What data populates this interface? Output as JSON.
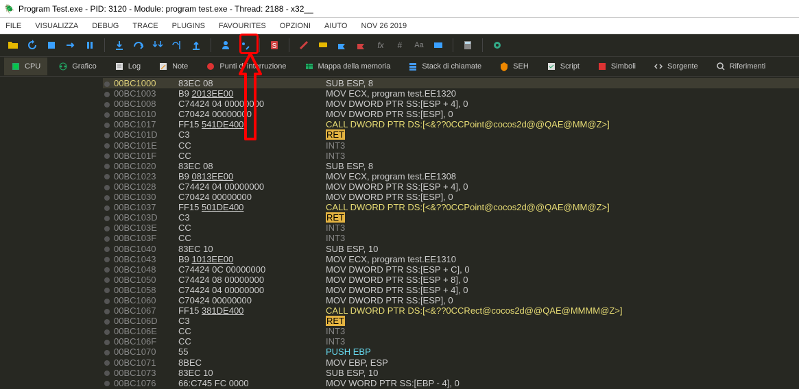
{
  "title": "Program Test.exe - PID: 3120 - Module: program test.exe - Thread: 2188 - x32__",
  "menus": [
    "FILE",
    "VISUALIZZA",
    "DEBUG",
    "TRACE",
    "PLUGINS",
    "FAVOURITES",
    "OPZIONI",
    "AIUTO",
    "NOV 26 2019"
  ],
  "tabs": [
    {
      "label": "CPU",
      "active": true,
      "id": "cpu"
    },
    {
      "label": "Grafico",
      "active": false,
      "id": "grafico"
    },
    {
      "label": "Log",
      "active": false,
      "id": "log"
    },
    {
      "label": "Note",
      "active": false,
      "id": "note"
    },
    {
      "label": "Punti di interruzione",
      "active": false,
      "id": "breakpoints"
    },
    {
      "label": "Mappa della memoria",
      "active": false,
      "id": "memmap"
    },
    {
      "label": "Stack di chiamate",
      "active": false,
      "id": "callstack"
    },
    {
      "label": "SEH",
      "active": false,
      "id": "seh"
    },
    {
      "label": "Script",
      "active": false,
      "id": "script"
    },
    {
      "label": "Simboli",
      "active": false,
      "id": "simboli"
    },
    {
      "label": "Sorgente",
      "active": false,
      "id": "sorgente"
    },
    {
      "label": "Riferimenti",
      "active": false,
      "id": "riferimenti"
    }
  ],
  "rows": [
    {
      "addr": "00BC1000",
      "sel": true,
      "b": "83EC 08",
      "bu": "",
      "ins": "SUB ESP, 8"
    },
    {
      "addr": "00BC1003",
      "b": "B9 ",
      "bu": "2013EE00",
      "ins": "MOV ECX, program test.EE1320"
    },
    {
      "addr": "00BC1008",
      "b": "C74424 04 00000000",
      "ins": "MOV DWORD PTR SS:[ESP + 4], 0"
    },
    {
      "addr": "00BC1010",
      "b": "C70424 00000000",
      "ins": "MOV DWORD PTR SS:[ESP], 0"
    },
    {
      "addr": "00BC1017",
      "b": "FF15 ",
      "bu": "541DE400",
      "ins": "CALL DWORD PTR DS:[<&??0CCPoint@cocos2d@@QAE@MM@Z>]",
      "kind": "call"
    },
    {
      "addr": "00BC101D",
      "b": "C3",
      "ins": "RET",
      "kind": "ret"
    },
    {
      "addr": "00BC101E",
      "b": "CC",
      "ins": "INT3",
      "kind": "int3"
    },
    {
      "addr": "00BC101F",
      "b": "CC",
      "ins": "INT3",
      "kind": "int3"
    },
    {
      "addr": "00BC1020",
      "b": "83EC 08",
      "ins": "SUB ESP, 8"
    },
    {
      "addr": "00BC1023",
      "b": "B9 ",
      "bu": "0813EE00",
      "ins": "MOV ECX, program test.EE1308"
    },
    {
      "addr": "00BC1028",
      "b": "C74424 04 00000000",
      "ins": "MOV DWORD PTR SS:[ESP + 4], 0"
    },
    {
      "addr": "00BC1030",
      "b": "C70424 00000000",
      "ins": "MOV DWORD PTR SS:[ESP], 0"
    },
    {
      "addr": "00BC1037",
      "b": "FF15 ",
      "bu": "501DE400",
      "ins": "CALL DWORD PTR DS:[<&??0CCPoint@cocos2d@@QAE@MM@Z>]",
      "kind": "call"
    },
    {
      "addr": "00BC103D",
      "b": "C3",
      "ins": "RET",
      "kind": "ret"
    },
    {
      "addr": "00BC103E",
      "b": "CC",
      "ins": "INT3",
      "kind": "int3"
    },
    {
      "addr": "00BC103F",
      "b": "CC",
      "ins": "INT3",
      "kind": "int3"
    },
    {
      "addr": "00BC1040",
      "b": "83EC 10",
      "ins": "SUB ESP, 10"
    },
    {
      "addr": "00BC1043",
      "b": "B9 ",
      "bu": "1013EE00",
      "ins": "MOV ECX, program test.EE1310"
    },
    {
      "addr": "00BC1048",
      "b": "C74424 0C 00000000",
      "ins": "MOV DWORD PTR SS:[ESP + C], 0"
    },
    {
      "addr": "00BC1050",
      "b": "C74424 08 00000000",
      "ins": "MOV DWORD PTR SS:[ESP + 8], 0"
    },
    {
      "addr": "00BC1058",
      "b": "C74424 04 00000000",
      "ins": "MOV DWORD PTR SS:[ESP + 4], 0"
    },
    {
      "addr": "00BC1060",
      "b": "C70424 00000000",
      "ins": "MOV DWORD PTR SS:[ESP], 0"
    },
    {
      "addr": "00BC1067",
      "b": "FF15 ",
      "bu": "381DE400",
      "ins": "CALL DWORD PTR DS:[<&??0CCRect@cocos2d@@QAE@MMMM@Z>]",
      "kind": "call"
    },
    {
      "addr": "00BC106D",
      "b": "C3",
      "ins": "RET",
      "kind": "ret"
    },
    {
      "addr": "00BC106E",
      "b": "CC",
      "ins": "INT3",
      "kind": "int3"
    },
    {
      "addr": "00BC106F",
      "b": "CC",
      "ins": "INT3",
      "kind": "int3"
    },
    {
      "addr": "00BC1070",
      "b": "55",
      "ins": "PUSH EBP",
      "kind": "push"
    },
    {
      "addr": "00BC1071",
      "b": "8BEC",
      "ins": "MOV EBP, ESP"
    },
    {
      "addr": "00BC1073",
      "b": "83EC 10",
      "ins": "SUB ESP, 10"
    },
    {
      "addr": "00BC1076",
      "b": "66:C745 FC 0000",
      "ins": "MOV WORD PTR SS:[EBP - 4], 0"
    }
  ]
}
